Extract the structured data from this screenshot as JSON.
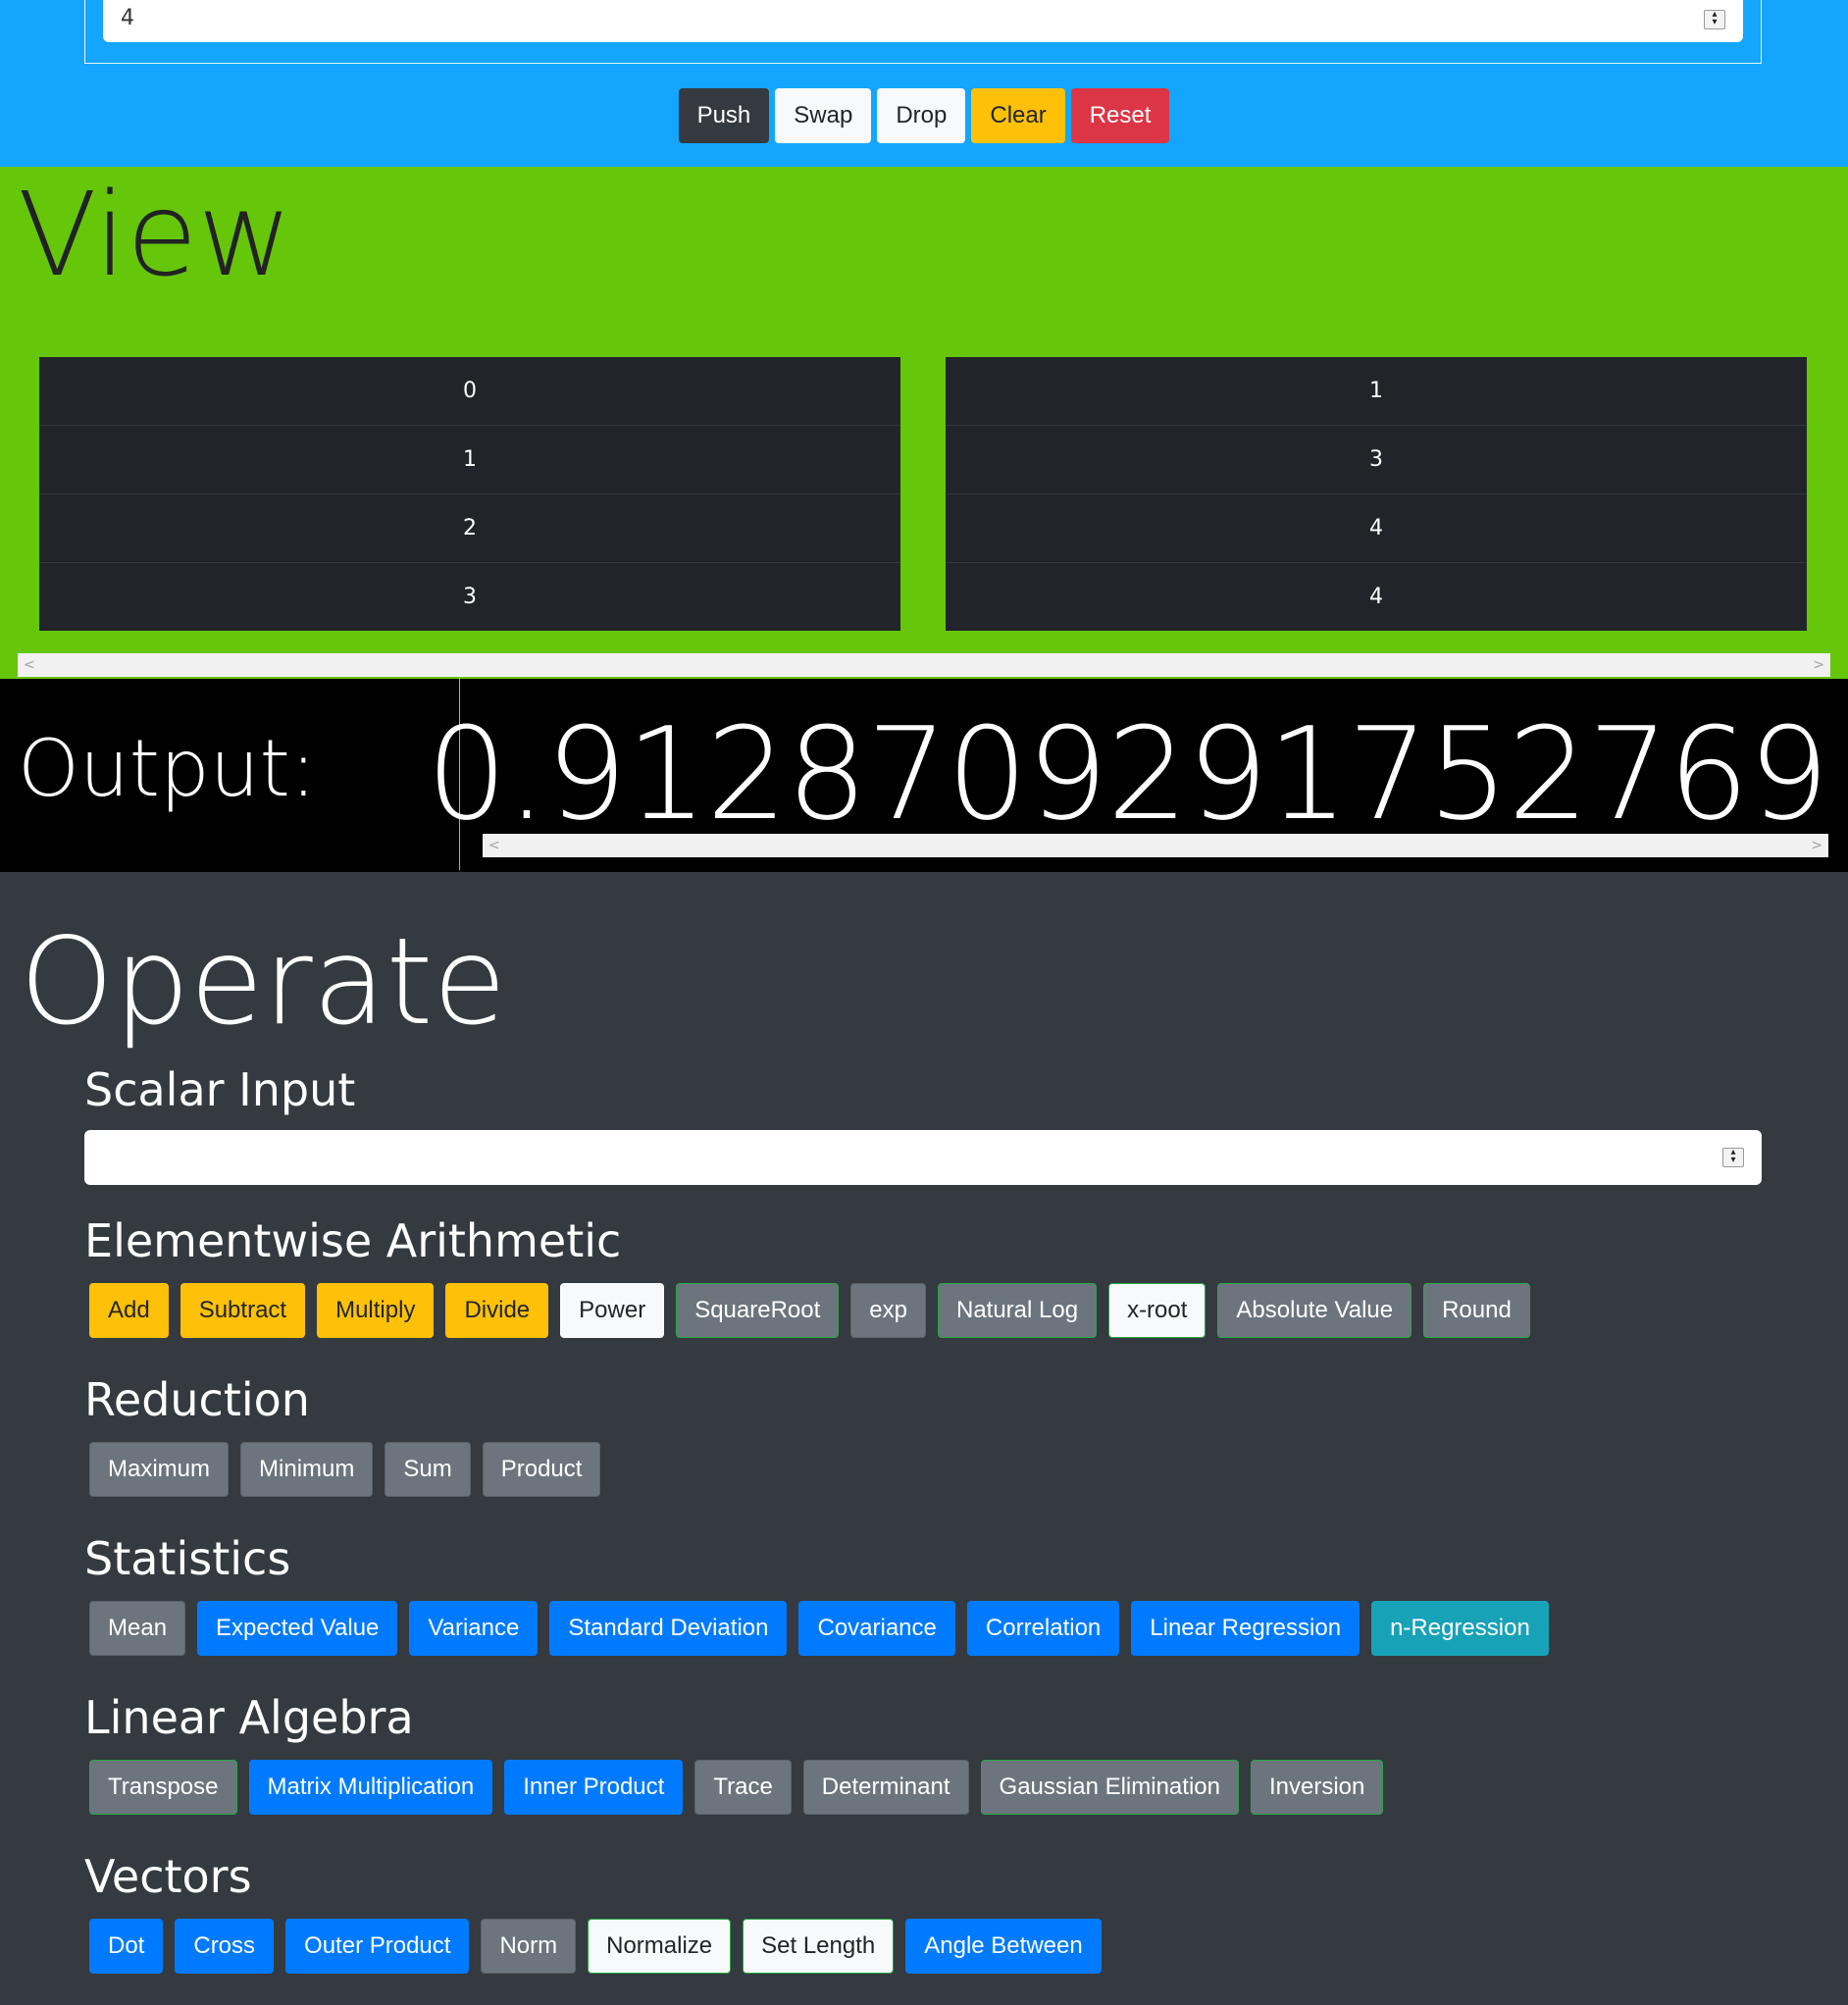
{
  "input": {
    "value": "4"
  },
  "stack_buttons": [
    {
      "label": "Push",
      "style": "dark"
    },
    {
      "label": "Swap",
      "style": "light"
    },
    {
      "label": "Drop",
      "style": "light"
    },
    {
      "label": "Clear",
      "style": "warning"
    },
    {
      "label": "Reset",
      "style": "danger"
    }
  ],
  "view": {
    "title": "View",
    "left_column": [
      "0",
      "1",
      "2",
      "3"
    ],
    "right_column": [
      "1",
      "3",
      "4",
      "4"
    ]
  },
  "output": {
    "label": "Output:",
    "value": "0.9128709291752769"
  },
  "operate": {
    "title": "Operate",
    "scalar_input": {
      "title": "Scalar Input",
      "value": ""
    },
    "groups": [
      {
        "title": "Elementwise Arithmetic",
        "buttons": [
          {
            "label": "Add",
            "style": "warning"
          },
          {
            "label": "Subtract",
            "style": "warning"
          },
          {
            "label": "Multiply",
            "style": "warning"
          },
          {
            "label": "Divide",
            "style": "warning"
          },
          {
            "label": "Power",
            "style": "light"
          },
          {
            "label": "SquareRoot",
            "style": "sec-green"
          },
          {
            "label": "exp",
            "style": "secondary"
          },
          {
            "label": "Natural Log",
            "style": "sec-green"
          },
          {
            "label": "x-root",
            "style": "light-green"
          },
          {
            "label": "Absolute Value",
            "style": "sec-green"
          },
          {
            "label": "Round",
            "style": "sec-green"
          }
        ]
      },
      {
        "title": "Reduction",
        "buttons": [
          {
            "label": "Maximum",
            "style": "secondary"
          },
          {
            "label": "Minimum",
            "style": "secondary"
          },
          {
            "label": "Sum",
            "style": "secondary"
          },
          {
            "label": "Product",
            "style": "secondary"
          }
        ]
      },
      {
        "title": "Statistics",
        "buttons": [
          {
            "label": "Mean",
            "style": "secondary"
          },
          {
            "label": "Expected Value",
            "style": "primary"
          },
          {
            "label": "Variance",
            "style": "primary"
          },
          {
            "label": "Standard Deviation",
            "style": "primary"
          },
          {
            "label": "Covariance",
            "style": "primary"
          },
          {
            "label": "Correlation",
            "style": "primary"
          },
          {
            "label": "Linear Regression",
            "style": "primary"
          },
          {
            "label": "n-Regression",
            "style": "info"
          }
        ]
      },
      {
        "title": "Linear Algebra",
        "buttons": [
          {
            "label": "Transpose",
            "style": "sec-green"
          },
          {
            "label": "Matrix Multiplication",
            "style": "primary"
          },
          {
            "label": "Inner Product",
            "style": "primary"
          },
          {
            "label": "Trace",
            "style": "secondary"
          },
          {
            "label": "Determinant",
            "style": "secondary"
          },
          {
            "label": "Gaussian Elimination",
            "style": "sec-green"
          },
          {
            "label": "Inversion",
            "style": "sec-green"
          }
        ]
      },
      {
        "title": "Vectors",
        "buttons": [
          {
            "label": "Dot",
            "style": "primary"
          },
          {
            "label": "Cross",
            "style": "primary"
          },
          {
            "label": "Outer Product",
            "style": "primary"
          },
          {
            "label": "Norm",
            "style": "secondary"
          },
          {
            "label": "Normalize",
            "style": "light-green"
          },
          {
            "label": "Set Length",
            "style": "light-green"
          },
          {
            "label": "Angle Between",
            "style": "primary"
          }
        ]
      }
    ]
  }
}
